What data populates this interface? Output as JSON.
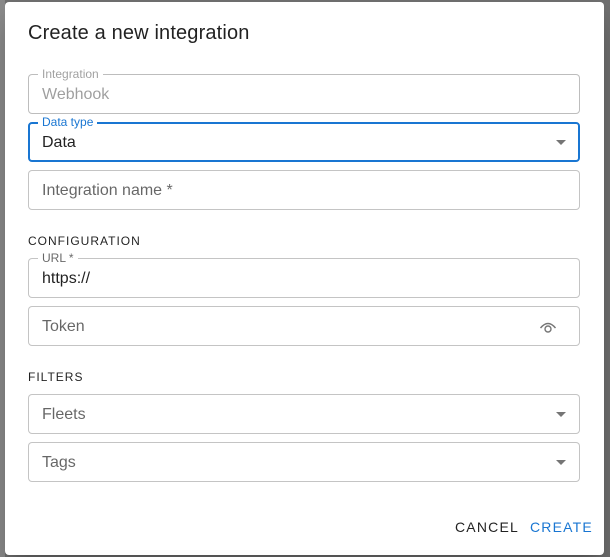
{
  "dialog": {
    "title": "Create a new integration"
  },
  "fields": {
    "integration": {
      "label": "Integration",
      "value": "Webhook"
    },
    "data_type": {
      "label": "Data type",
      "value": "Data"
    },
    "integration_name": {
      "placeholder": "Integration name *"
    },
    "url": {
      "label": "URL *",
      "value": "https://"
    },
    "token": {
      "placeholder": "Token"
    },
    "fleets": {
      "placeholder": "Fleets"
    },
    "tags": {
      "placeholder": "Tags"
    }
  },
  "sections": {
    "configuration": "CONFIGURATION",
    "filters": "FILTERS"
  },
  "actions": {
    "cancel_label": "CANCEL",
    "create_label": "CREATE"
  },
  "icons": {
    "token_toggle": "eye-icon",
    "dropdown": "chevron-down-icon"
  },
  "colors": {
    "accent": "#1976d2"
  }
}
